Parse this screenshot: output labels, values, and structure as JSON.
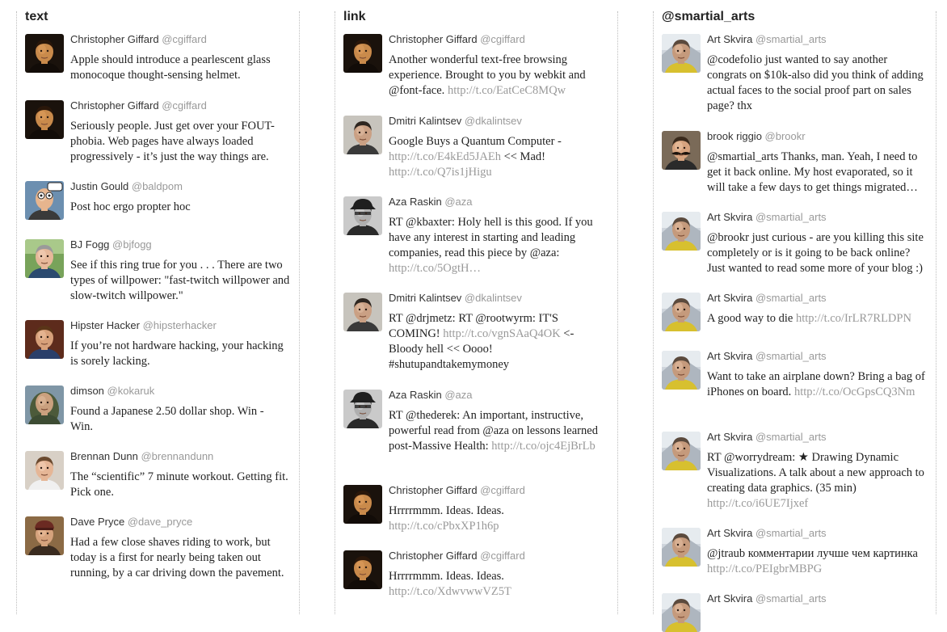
{
  "columns": [
    {
      "title": "text",
      "tweets": [
        {
          "name": "Christopher Giffard",
          "handle": "@cgiffard",
          "avatar": "cgiffard",
          "text": "Apple should introduce a pearlescent glass monocoque thought-sensing helmet.",
          "link": ""
        },
        {
          "name": "Christopher Giffard",
          "handle": "@cgiffard",
          "avatar": "cgiffard",
          "text": "Seriously people. Just get over your FOUT-phobia. Web pages have always loaded progressively - it’s just the way things are.",
          "link": ""
        },
        {
          "name": "Justin Gould",
          "handle": "@baldpom",
          "avatar": "baldpom",
          "text": "Post hoc ergo propter hoc",
          "link": ""
        },
        {
          "name": "BJ Fogg",
          "handle": "@bjfogg",
          "avatar": "bjfogg",
          "text": "See if this ring true for you . . . There are two types of willpower: \"fast-twitch willpower and slow-twitch willpower.\"",
          "link": ""
        },
        {
          "name": "Hipster Hacker",
          "handle": "@hipsterhacker",
          "avatar": "hipsterhacker",
          "text": "If you’re not hardware hacking, your hacking is sorely lacking.",
          "link": ""
        },
        {
          "name": "dimson",
          "handle": "@kokaruk",
          "avatar": "kokaruk",
          "text": "Found a Japanese 2.50 dollar shop. Win - Win.",
          "link": ""
        },
        {
          "name": "Brennan Dunn",
          "handle": "@brennandunn",
          "avatar": "brennandunn",
          "text": "The “scientific” 7 minute workout. Getting fit. Pick one.",
          "link": ""
        },
        {
          "name": "Dave Pryce",
          "handle": "@dave_pryce",
          "avatar": "dave_pryce",
          "text": "Had a few close shaves riding to work, but today is a first for nearly being taken out running, by a car driving down the pavement.",
          "link": ""
        }
      ]
    },
    {
      "title": "link",
      "tweets": [
        {
          "name": "Christopher Giffard",
          "handle": "@cgiffard",
          "avatar": "cgiffard",
          "text": "Another wonderful text-free browsing experience. Brought to you by webkit and @font-face.",
          "link": "http://t.co/EatCeC8MQw"
        },
        {
          "name": "Dmitri Kalintsev",
          "handle": "@dkalintsev",
          "avatar": "dkalintsev",
          "text": "Google Buys a Quantum Computer -",
          "link": "http://t.co/E4kEd5JAEh",
          "text2": "<< Mad!",
          "link2": "http://t.co/Q7is1jHigu"
        },
        {
          "name": "Aza Raskin",
          "handle": "@aza",
          "avatar": "aza",
          "text": "RT @kbaxter: Holy hell is this good. If you have any interest in starting and leading companies, read this piece by @aza:",
          "link": "http://t.co/5OgtH…"
        },
        {
          "name": "Dmitri Kalintsev",
          "handle": "@dkalintsev",
          "avatar": "dkalintsev",
          "text": "RT @drjmetz: RT @rootwyrm: IT'S COMING!",
          "link": "http://t.co/vgnSAaQ4OK",
          "text2": "<- Bloody hell << Oooo! #shutupandtakemymoney",
          "link2": ""
        },
        {
          "name": "Aza Raskin",
          "handle": "@aza",
          "avatar": "aza",
          "text": "RT @thederek: An important, instructive, powerful read from @aza on lessons learned post-Massive Health:",
          "link": "http://t.co/ojc4EjBrLb"
        },
        {
          "name": "Christopher Giffard",
          "handle": "@cgiffard",
          "avatar": "cgiffard",
          "text": "Hrrrrmmm. Ideas. Ideas.",
          "link": "http://t.co/cPbxXP1h6p"
        },
        {
          "name": "Christopher Giffard",
          "handle": "@cgiffard",
          "avatar": "cgiffard",
          "text": "Hrrrrmmm. Ideas. Ideas.",
          "link": "http://t.co/XdwvwwVZ5T"
        }
      ]
    },
    {
      "title": "@smartial_arts",
      "tweets": [
        {
          "name": "Art Skvira",
          "handle": "@smartial_arts",
          "avatar": "smartial_arts",
          "text": "@codefolio just wanted to say another congrats on $10k-also did you think of adding actual faces to the social proof part on sales page? thx",
          "link": ""
        },
        {
          "name": "brook riggio",
          "handle": "@brookr",
          "avatar": "brookr",
          "text": "@smartial_arts Thanks, man. Yeah, I need to get it back online. My host evaporated, so it will take a few days to get things migrated…",
          "link": ""
        },
        {
          "name": "Art Skvira",
          "handle": "@smartial_arts",
          "avatar": "smartial_arts",
          "text": "@brookr just curious - are you killing this site completely or is it going to be back online? Just wanted to read some more of your blog :)",
          "link": ""
        },
        {
          "name": "Art Skvira",
          "handle": "@smartial_arts",
          "avatar": "smartial_arts",
          "text": "A good way to die",
          "link": "http://t.co/IrLR7RLDPN"
        },
        {
          "name": "Art Skvira",
          "handle": "@smartial_arts",
          "avatar": "smartial_arts",
          "text": "Want to take an airplane down? Bring a bag of iPhones on board.",
          "link": "http://t.co/OcGpsCQ3Nm"
        },
        {
          "name": "Art Skvira",
          "handle": "@smartial_arts",
          "avatar": "smartial_arts",
          "text": "RT @worrydream: ★ Drawing Dynamic Visualizations. A talk about a new approach to creating data graphics. (35 min)",
          "link": "http://t.co/i6UE7Ijxef"
        },
        {
          "name": "Art Skvira",
          "handle": "@smartial_arts",
          "avatar": "smartial_arts",
          "text": "@jtraub комментарии лучше чем картинка",
          "link": "http://t.co/PEIgbrMBPG"
        },
        {
          "name": "Art Skvira",
          "handle": "@smartial_arts",
          "avatar": "smartial_arts",
          "text": "",
          "link": ""
        }
      ]
    }
  ]
}
